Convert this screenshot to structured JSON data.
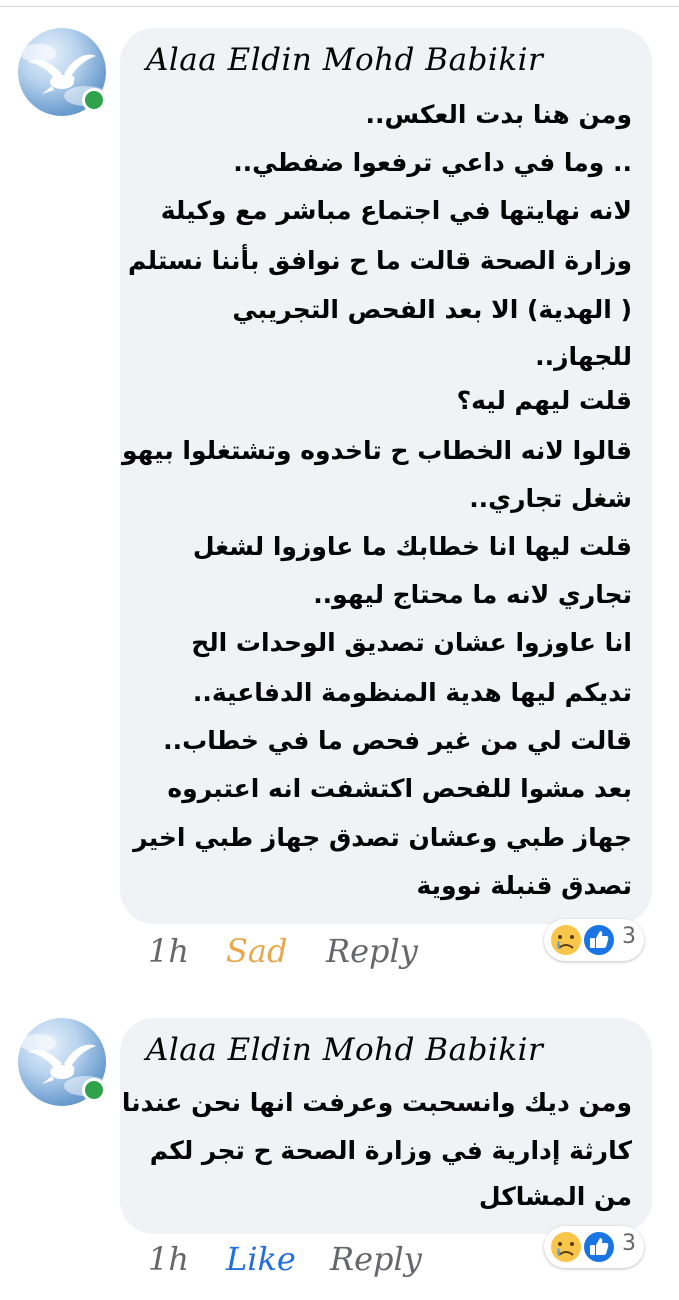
{
  "comments": [
    {
      "author": "Alaa Eldin Mohd Babikir",
      "lines": [
        "ومن هنا بدت العكس..",
        ".. وما في داعي ترفعوا ضفطي..",
        "لانه نهايتها في اجتماع مباشر مع وكيلة",
        "وزارة الصحة قالت ما ح نوافق بأننا نستلم",
        "( الهدية) الا بعد الفحص التجريبي",
        "للجهاز..",
        "قلت ليهم ليه؟",
        "قالوا لانه الخطاب ح تاخدوه وتشتغلوا بيهو",
        "شغل تجاري..",
        "قلت ليها انا خطابك ما عاوزوا لشغل",
        "تجاري لانه ما محتاج ليهو..",
        "انا عاوزوا عشان تصديق الوحدات الح",
        "تديكم ليها هدية المنظومة الدفاعية..",
        "قالت لي من غير فحص ما في خطاب..",
        "بعد مشوا للفحص اكتشفت انه اعتبروه",
        "جهاز طبي وعشان تصدق جهاز طبي اخير",
        "تصدق قنبلة نووية"
      ],
      "time": "1h",
      "reaction_label": "Sad",
      "reply_label": "Reply",
      "reaction_count": "3"
    },
    {
      "author": "Alaa Eldin Mohd Babikir",
      "lines": [
        "ومن ديك وانسحبت وعرفت انها نحن عندنا",
        "كارثة إدارية في وزارة الصحة ح تجر لكم",
        "من المشاكل"
      ],
      "time": "1h",
      "reaction_label": "Like",
      "reply_label": "Reply",
      "reaction_count": "3"
    }
  ],
  "colors": {
    "bubble": "#f0f2f5",
    "sad_reaction": "#e8a94c",
    "like_action": "#216fdb",
    "online": "#31a24c"
  },
  "icons": {
    "avatar": "dove-in-sky",
    "sad_reaction": "sad-face-emoji",
    "like_reaction": "thumbs-up"
  }
}
